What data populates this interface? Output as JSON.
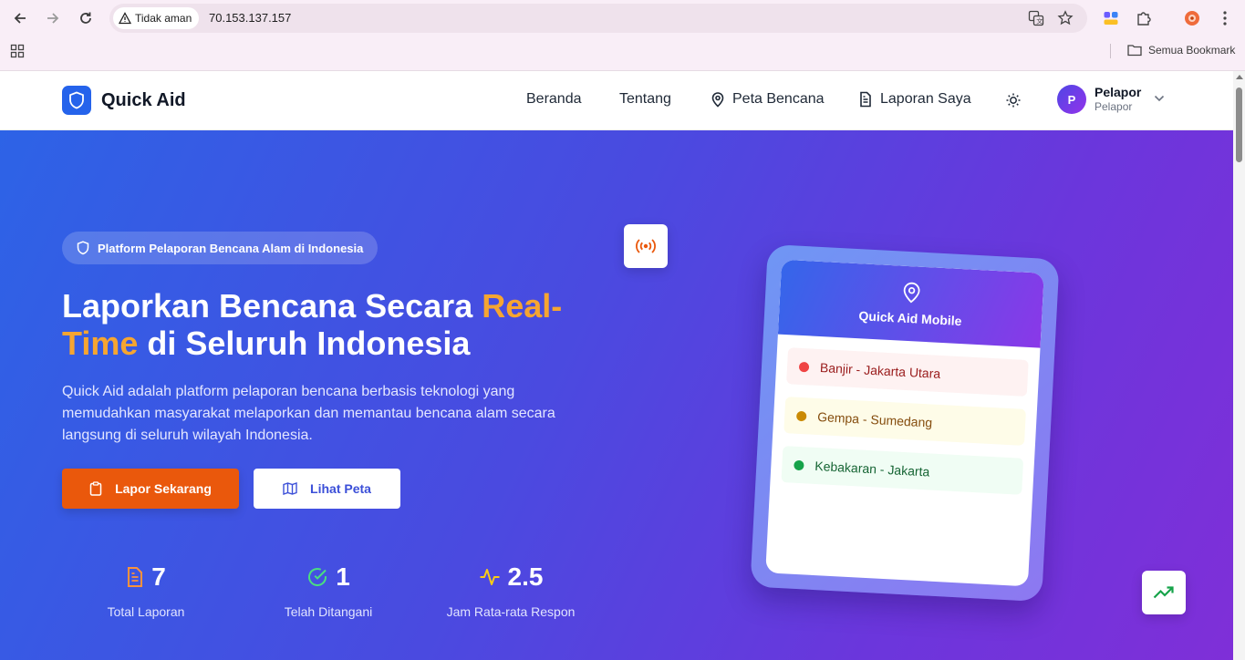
{
  "browser": {
    "security_label": "Tidak aman",
    "url": "70.153.137.157",
    "all_bookmarks_label": "Semua Bookmark"
  },
  "header": {
    "brand": "Quick Aid",
    "nav": {
      "home": "Beranda",
      "about": "Tentang",
      "map": "Peta Bencana",
      "reports": "Laporan Saya"
    },
    "user": {
      "initial": "P",
      "name": "Pelapor",
      "role": "Pelapor"
    }
  },
  "hero": {
    "badge": "Platform Pelaporan Bencana Alam di Indonesia",
    "headline_part1": "Laporkan Bencana Secara ",
    "headline_accent": "Real-Time",
    "headline_part2": " di Seluruh Indonesia",
    "description": "Quick Aid adalah platform pelaporan bencana berbasis teknologi yang memudahkan masyarakat melaporkan dan memantau bencana alam secara langsung di seluruh wilayah Indonesia.",
    "primary_button": "Lapor Sekarang",
    "secondary_button": "Lihat Peta",
    "stats": [
      {
        "value": "7",
        "label": "Total Laporan",
        "color": "#fb923c"
      },
      {
        "value": "1",
        "label": "Telah Ditangani",
        "color": "#4ade80"
      },
      {
        "value": "2.5",
        "label": "Jam Rata-rata Respon",
        "color": "#facc15"
      }
    ]
  },
  "phone_mockup": {
    "title": "Quick Aid Mobile",
    "items": [
      {
        "text": "Banjir - Jakarta Utara",
        "dot": "#ef4444",
        "bg": "#fef2f2",
        "fg": "#991b1b"
      },
      {
        "text": "Gempa - Sumedang",
        "dot": "#ca8a04",
        "bg": "#fefce8",
        "fg": "#854d0e"
      },
      {
        "text": "Kebakaran - Jakarta",
        "dot": "#16a34a",
        "bg": "#f0fdf4",
        "fg": "#166534"
      }
    ]
  },
  "colors": {
    "brand": "#2563eb",
    "primary_button": "#ea580c",
    "accent_text": "#f6a531"
  }
}
